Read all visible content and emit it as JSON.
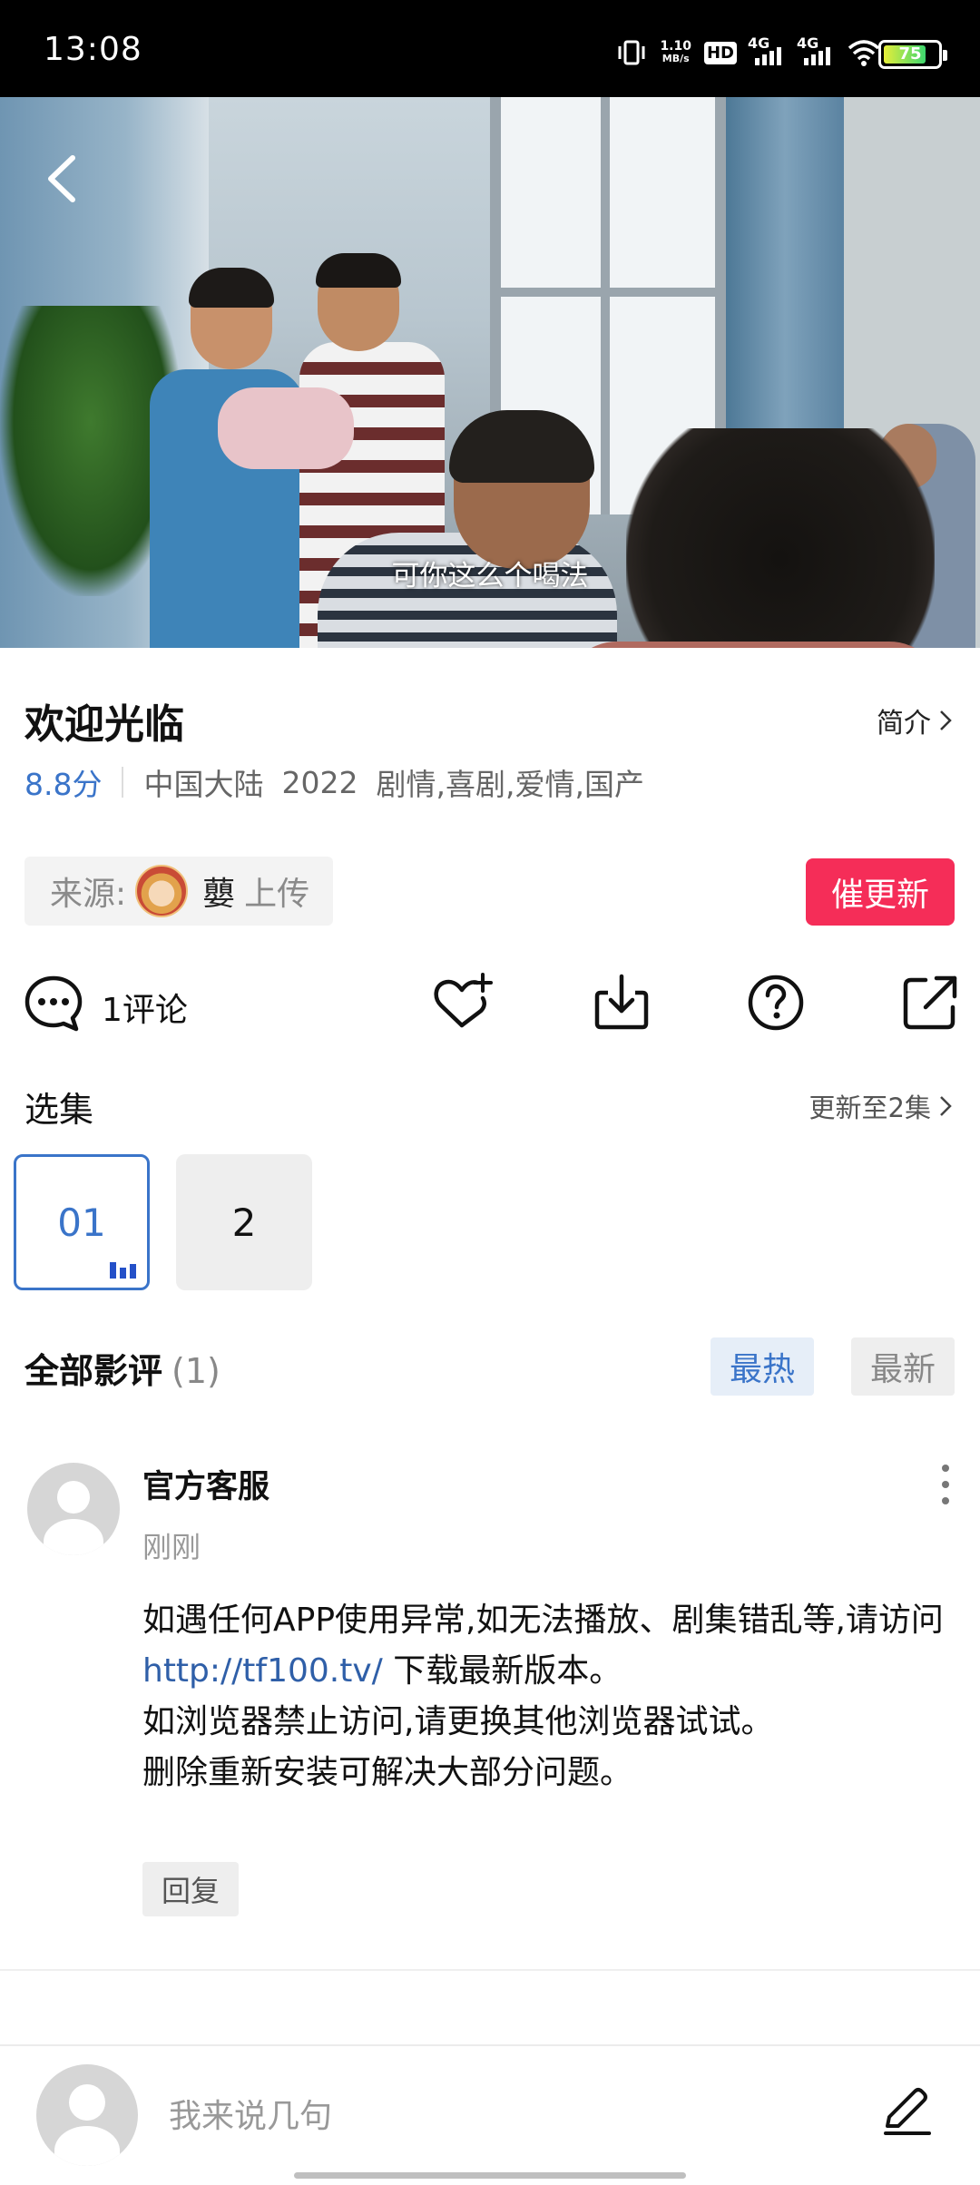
{
  "status_bar": {
    "time": "13:08",
    "net_speed_value": "1.10",
    "net_speed_unit": "MB/s",
    "hd_label": "HD",
    "sim1_label": "4G",
    "sim2_label": "4G",
    "battery_level": "75"
  },
  "video": {
    "subtitle": "可你这么个喝法"
  },
  "show": {
    "title": "欢迎光临",
    "intro_label": "简介",
    "score": "8.8分",
    "region": "中国大陆",
    "year": "2022",
    "genres": "剧情,喜剧,爱情,国产"
  },
  "source": {
    "label": "来源:",
    "uploader": "蘡",
    "action": "上传",
    "urge_button": "催更新"
  },
  "actions": {
    "comment_count": "1评论"
  },
  "episodes": {
    "title": "选集",
    "more": "更新至2集",
    "items": [
      {
        "label": "01",
        "active": true
      },
      {
        "label": "2",
        "active": false
      }
    ]
  },
  "reviews": {
    "title": "全部影评",
    "count": "(1)",
    "sort_hot": "最热",
    "sort_new": "最新"
  },
  "comment": {
    "author": "官方客服",
    "time": "刚刚",
    "line1": "如遇任何APP使用异常,如无法播放、剧集错乱等,请访问",
    "link": "http://tf100.tv/",
    "line2": " 下载最新版本。",
    "line3": "如浏览器禁止访问,请更换其他浏览器试试。",
    "line4": "删除重新安装可解决大部分问题。",
    "reply": "回复"
  },
  "bottom_bar": {
    "input_placeholder": "我来说几句"
  },
  "colors": {
    "accent_blue": "#3a74c9",
    "urge_red": "#f52d58",
    "link_blue": "#2f5fa8"
  }
}
